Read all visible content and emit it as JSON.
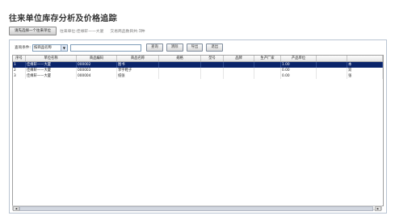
{
  "title": "往来单位库存分析及价格追踪",
  "toolbar": {
    "choose_button": "请先选择一个往来单位",
    "unit_label": "往来单位:佳缘轩——大厦",
    "goods_count": "交易商品数目共:3种"
  },
  "query": {
    "label": "查询条件:",
    "select_value": "按商品名称",
    "buttons": [
      "查询",
      "清除",
      "导出",
      "退出"
    ]
  },
  "table": {
    "columns": [
      "序号",
      "单位名称",
      "商品编码",
      "商品名称",
      "规格",
      "型号",
      "品牌",
      "生产厂家",
      "产品单位",
      "",
      ""
    ],
    "rows": [
      [
        "1",
        "佳缘轩——大厦",
        "000002",
        "图书",
        "",
        "",
        "",
        "",
        "1.00",
        "",
        "本"
      ],
      [
        "2",
        "佳缘轩——大厦",
        "000003",
        "李宇鞋子",
        "",
        "",
        "",
        "",
        "0.00",
        "",
        "双"
      ],
      [
        "3",
        "佳缘轩——大厦",
        "000004",
        "纸张",
        "",
        "",
        "",
        "",
        "0.00",
        "",
        "张"
      ]
    ],
    "selected_row": 0
  },
  "scrollbar": {
    "left_arrow": "◀",
    "right_arrow": "▶"
  }
}
